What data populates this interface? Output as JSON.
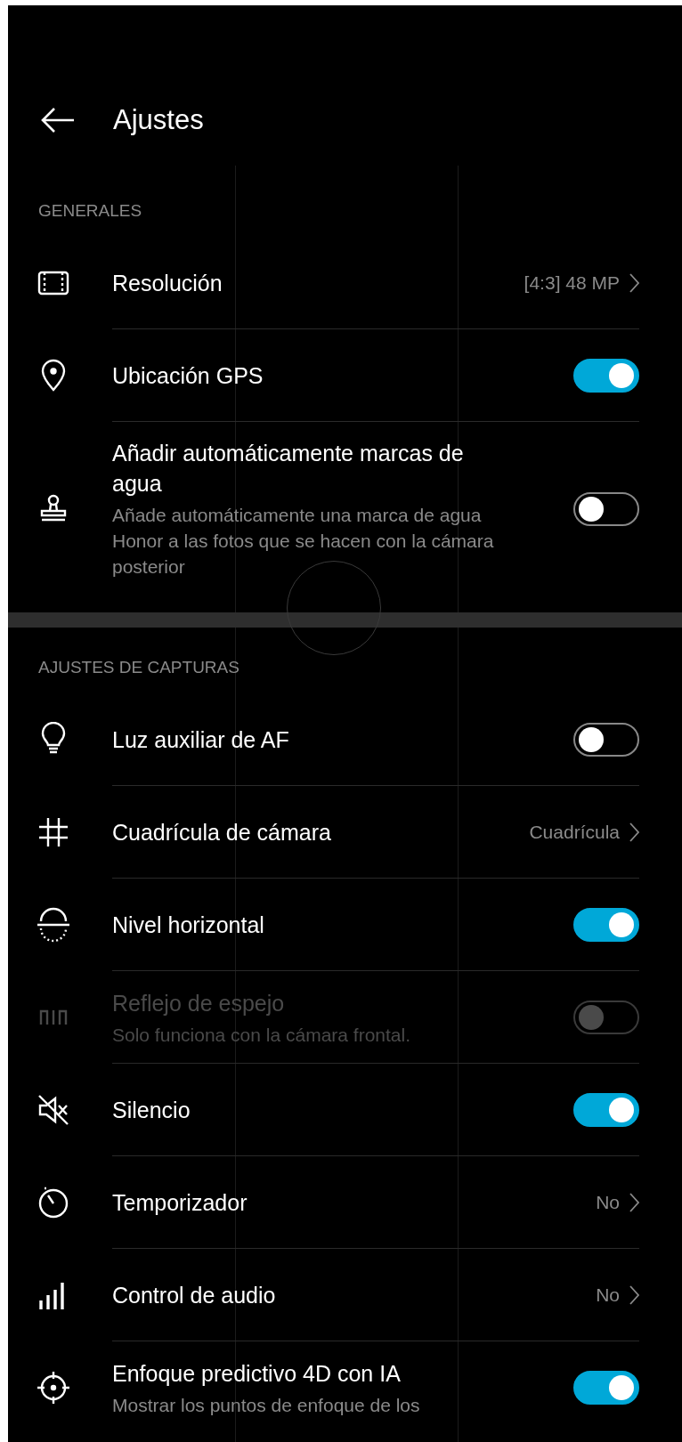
{
  "header": {
    "title": "Ajustes"
  },
  "sections": [
    {
      "title": "GENERALES",
      "items": [
        {
          "kind": "value",
          "label": "Resolución",
          "value": "[4:3] 48 MP",
          "disabled": false
        },
        {
          "kind": "toggle",
          "label": "Ubicación GPS",
          "on": true,
          "disabled": false
        },
        {
          "kind": "toggle",
          "label": "Añadir automáticamente marcas de agua",
          "description": "Añade automáticamente una marca de agua Honor a las fotos que se hacen con la cámara posterior",
          "on": false,
          "disabled": false
        }
      ]
    },
    {
      "title": "AJUSTES DE CAPTURAS",
      "items": [
        {
          "kind": "toggle",
          "label": "Luz auxiliar de AF",
          "on": false,
          "disabled": false
        },
        {
          "kind": "value",
          "label": "Cuadrícula de cámara",
          "value": "Cuadrícula",
          "disabled": false
        },
        {
          "kind": "toggle",
          "label": "Nivel horizontal",
          "on": true,
          "disabled": false
        },
        {
          "kind": "toggle",
          "label": "Reflejo de espejo",
          "description": "Solo funciona con la cámara frontal.",
          "on": false,
          "disabled": true
        },
        {
          "kind": "toggle",
          "label": "Silencio",
          "on": true,
          "disabled": false
        },
        {
          "kind": "value",
          "label": "Temporizador",
          "value": "No",
          "disabled": false
        },
        {
          "kind": "value",
          "label": "Control de audio",
          "value": "No",
          "disabled": false
        },
        {
          "kind": "toggle",
          "label": "Enfoque predictivo 4D con IA",
          "description": "Mostrar los puntos de enfoque de los",
          "on": true,
          "disabled": false
        }
      ]
    }
  ]
}
